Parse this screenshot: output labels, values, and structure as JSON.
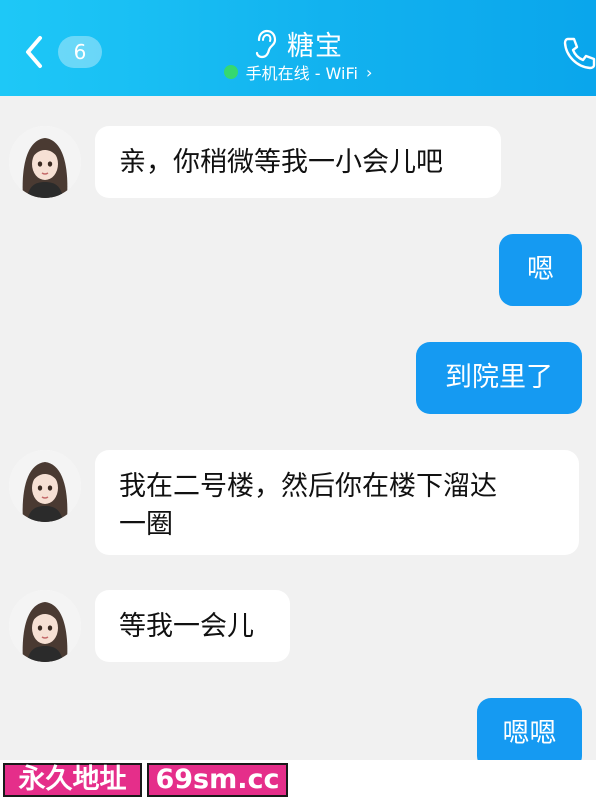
{
  "header": {
    "unread_count": "6",
    "title": "糖宝",
    "status": "手机在线 - WiFi",
    "status_chevron": "›",
    "colors": {
      "bar_start": "#1ec8f7",
      "bar_end": "#0aa6ec",
      "online_dot": "#35d870"
    },
    "icons": [
      "back-chevron-icon",
      "ear-icon",
      "phone-icon"
    ]
  },
  "messages": [
    {
      "side": "left",
      "text": "亲，你稍微等我一小会儿吧"
    },
    {
      "side": "right",
      "text": "嗯"
    },
    {
      "side": "right",
      "text": "到院里了"
    },
    {
      "side": "left",
      "text_line1": "我在二号楼，然后你在楼下溜达",
      "text_line2": "一圈"
    },
    {
      "side": "left",
      "text": "等我一会儿"
    },
    {
      "side": "right",
      "text": "嗯嗯"
    }
  ],
  "footer": {
    "tag1": "永久地址",
    "tag2": "69sm.cc",
    "tag_color": "#e52e8a"
  },
  "colors": {
    "sent_bubble": "#159af2",
    "received_bubble": "#ffffff",
    "background": "#f1f1f1"
  }
}
